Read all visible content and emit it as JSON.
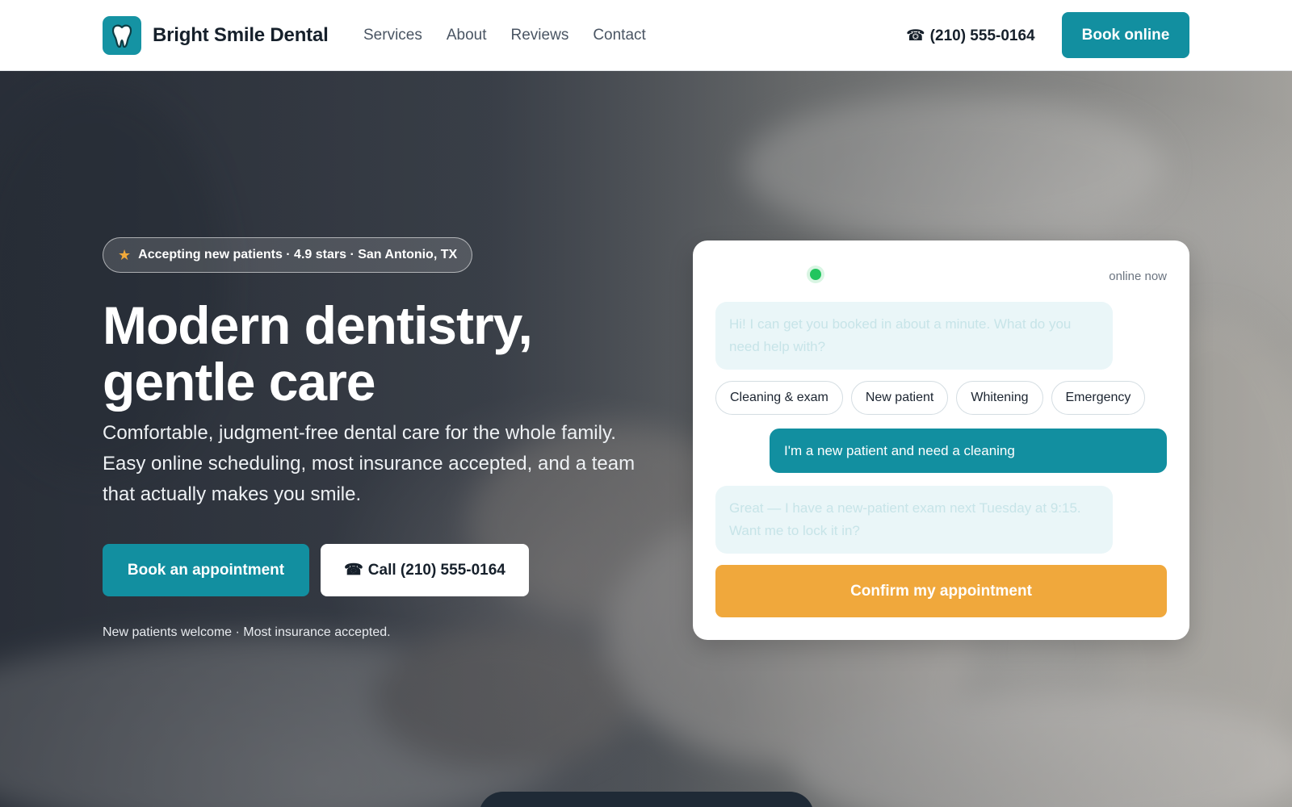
{
  "header": {
    "brand": "Bright Smile Dental",
    "logo_icon": "tooth-icon",
    "nav": [
      "Services",
      "About",
      "Reviews",
      "Contact"
    ],
    "phone": "(210) 555-0164",
    "phone_icon": "phone-icon",
    "book_button": "Book online"
  },
  "hero": {
    "badge": "Accepting new patients · 4.9 stars · San Antonio, TX",
    "badge_icon": "star-icon",
    "headline_line1": "Modern dentistry,",
    "headline_line2": "gentle care",
    "subcopy": "Comfortable, judgment-free dental care for the whole family. Easy online scheduling, most insurance accepted, and a team that actually makes you smile.",
    "primary_button": "Book an appointment",
    "secondary_button": "Call (210) 555-0164",
    "footnote": "New patients welcome · Most insurance accepted."
  },
  "chat": {
    "status": "online now",
    "bot_message_1": "Hi! I can get you booked in about a minute. What do you need help with?",
    "chips": [
      "Cleaning & exam",
      "New patient",
      "Whitening",
      "Emergency"
    ],
    "user_message": "I'm a new patient and need a cleaning",
    "bot_message_2": "Great — I have a new-patient exam next Tuesday at 9:15. Want me to lock it in?",
    "confirm_button": "Confirm my appointment"
  },
  "colors": {
    "primary": "#128fa0",
    "accent": "#f0a83c",
    "online": "#22c55e"
  }
}
